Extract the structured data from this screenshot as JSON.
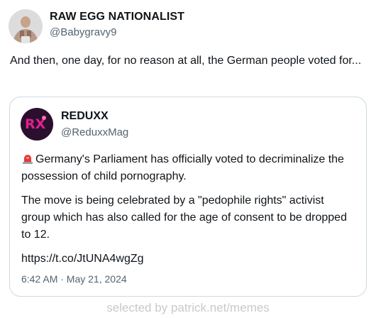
{
  "tweet": {
    "display_name": "RAW EGG NATIONALIST",
    "handle": "@Babygravy9",
    "text": "And then, one day, for no reason at all, the German people voted for..."
  },
  "quoted_tweet": {
    "display_name": "REDUXX",
    "handle": "@ReduxxMag",
    "paragraph_1": "Germany's Parliament has officially voted to decriminalize the possession of child pornography.",
    "paragraph_2": "The move is being celebrated by a \"pedophile rights\" activist group which has also called for the age of consent to be dropped to 12.",
    "link": "https://t.co/JtUNA4wgZg",
    "timestamp": "6:42 AM · May 21, 2024",
    "avatar_logo": "RX",
    "siren_icon": "police-light-emoji"
  },
  "watermark": "selected by patrick.net/memes",
  "colors": {
    "text_primary": "#0f1419",
    "text_secondary": "#536471",
    "border": "#cfd9de",
    "reduxx_avatar_bg": "#2b0f2e",
    "reduxx_logo": "#e0218a",
    "watermark": "#c9c9c9"
  }
}
